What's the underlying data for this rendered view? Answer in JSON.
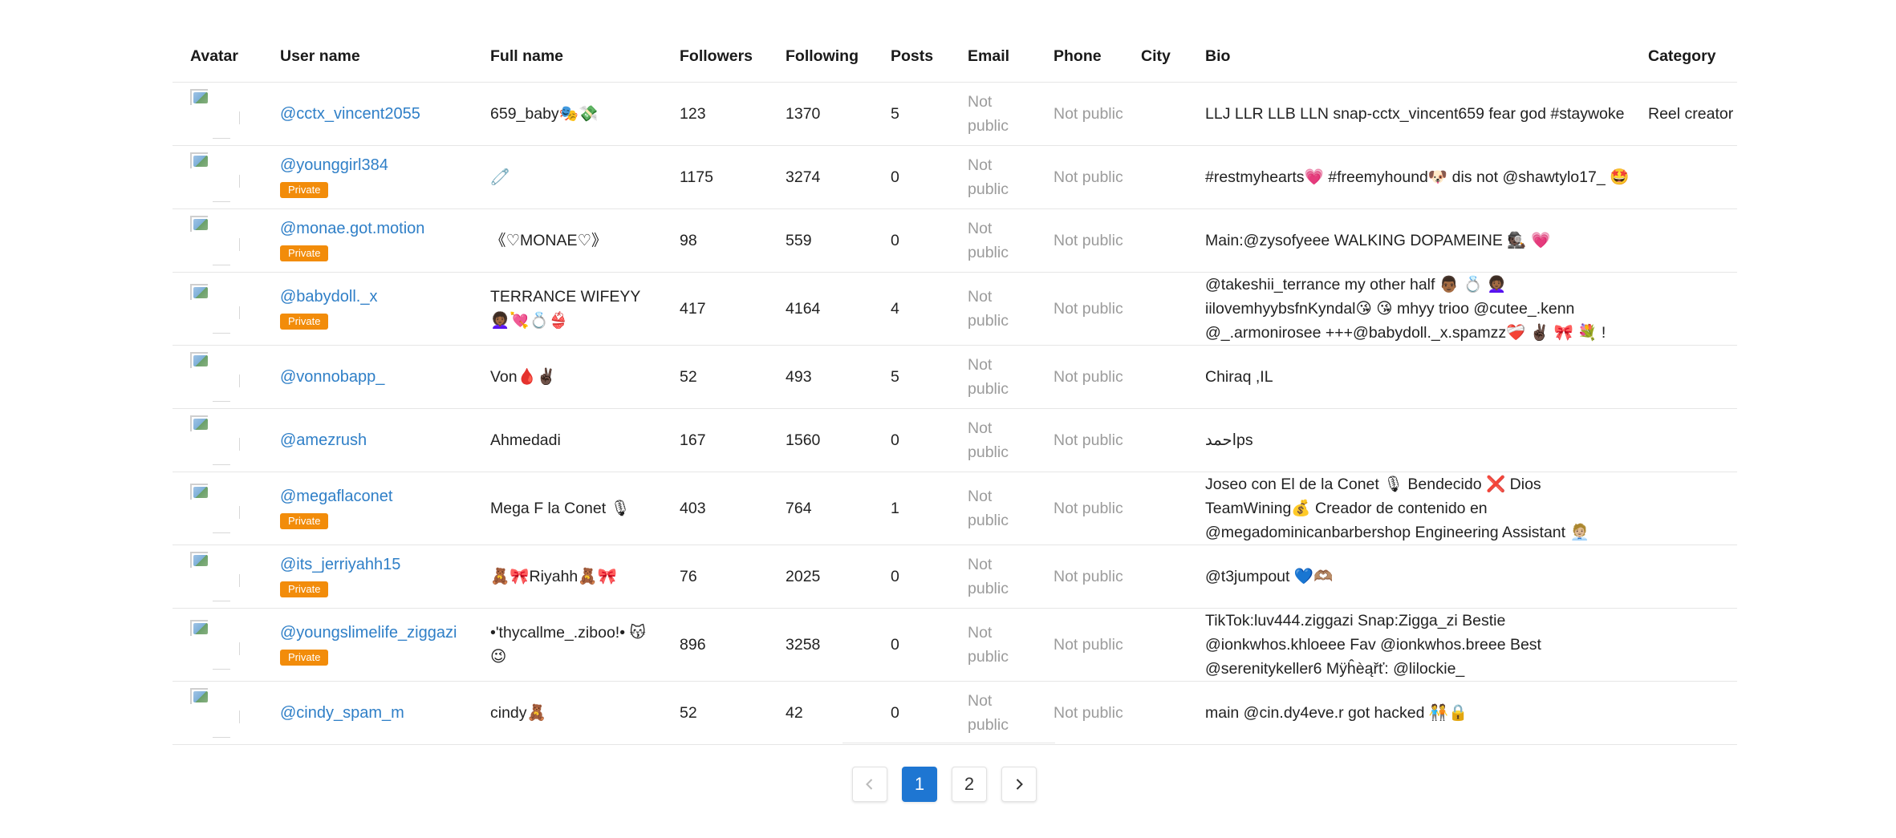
{
  "columns": {
    "avatar": "Avatar",
    "username": "User name",
    "fullname": "Full name",
    "followers": "Followers",
    "following": "Following",
    "posts": "Posts",
    "email": "Email",
    "phone": "Phone",
    "city": "City",
    "bio": "Bio",
    "category": "Category"
  },
  "not_public": "Not public",
  "private_label": "Private",
  "rows": [
    {
      "username": "@cctx_vincent2055",
      "private": false,
      "fullname": "659_baby🎭💸",
      "followers": "123",
      "following": "1370",
      "posts": "5",
      "city": "",
      "bio": "LLJ LLR LLB LLN snap-cctx_vincent659 fear god #staywoke",
      "category": "Reel creator"
    },
    {
      "username": "@younggirl384",
      "private": true,
      "fullname": "🧷",
      "followers": "1175",
      "following": "3274",
      "posts": "0",
      "city": "",
      "bio": "#restmyhearts💗 #freemyhound🐶 dis not @shawtylo17_ 🤩",
      "category": ""
    },
    {
      "username": "@monae.got.motion",
      "private": true,
      "fullname": "《♡MONAE♡》",
      "followers": "98",
      "following": "559",
      "posts": "0",
      "city": "",
      "bio": "Main:@zysofyeee WALKING DOPAMEINE 🕵🏿 💗",
      "category": ""
    },
    {
      "username": "@babydoll._x",
      "private": true,
      "fullname": "TERRANCE WIFEYY 👩🏾‍🦱💘💍👙",
      "followers": "417",
      "following": "4164",
      "posts": "4",
      "city": "",
      "bio": "@takeshii_terrance my other half 👨🏾 💍 👩🏾‍🦱 iilovemhyybsfnKyndal😘 😘 mhyy trioo @cutee_.kenn @_.armonirosee +++@babydoll._x.spamzz❤️‍🩹 ✌🏿 🎀 💐 !",
      "category": ""
    },
    {
      "username": "@vonnobapp_",
      "private": false,
      "fullname": "Von🩸✌🏿",
      "followers": "52",
      "following": "493",
      "posts": "5",
      "city": "",
      "bio": "Chiraq ,IL",
      "category": ""
    },
    {
      "username": "@amezrush",
      "private": false,
      "fullname": "Ahmedadi",
      "followers": "167",
      "following": "1560",
      "posts": "0",
      "city": "",
      "bio": "احمدps",
      "category": ""
    },
    {
      "username": "@megaflaconet",
      "private": true,
      "fullname": "Mega F la Conet 🎙",
      "followers": "403",
      "following": "764",
      "posts": "1",
      "city": "",
      "bio": "Joseo con El de la Conet 🎙 Bendecido ❌ Dios TeamWining💰 Creador de contenido en @megadominicanbarbershop Engineering Assistant 🧑🏼‍💼",
      "category": ""
    },
    {
      "username": "@its_jerriyahh15",
      "private": true,
      "fullname": "🧸🎀Riyahh🧸🎀",
      "followers": "76",
      "following": "2025",
      "posts": "0",
      "city": "",
      "bio": "@t3jumpout 💙🫶🏽",
      "category": ""
    },
    {
      "username": "@youngslimelife_ziggazi",
      "private": true,
      "fullname": "•'thycallme_.ziboo!• 😽😉",
      "followers": "896",
      "following": "3258",
      "posts": "0",
      "city": "",
      "bio": "TikTok:luv444.ziggazi Snap:Zigga_zi Bestie @ionkwhos.khloeee Fav @ionkwhos.breee Best @serenitykeller6 Mÿĥèąřť: @lilockie_",
      "category": ""
    },
    {
      "username": "@cindy_spam_m",
      "private": false,
      "fullname": "cindy🧸",
      "followers": "52",
      "following": "42",
      "posts": "0",
      "city": "",
      "bio": "main @cin.dy4eve.r got hacked 🧑‍🤝‍🧑🔒",
      "category": ""
    }
  ],
  "pagination": {
    "prev_icon": "chevron-left-icon",
    "next_icon": "chevron-right-icon",
    "pages": [
      "1",
      "2"
    ],
    "current": "1"
  },
  "colors": {
    "link": "#2f7fc7",
    "private_badge": "#f28c0a",
    "active_page": "#1e76d2",
    "muted": "#9b9b9b"
  }
}
